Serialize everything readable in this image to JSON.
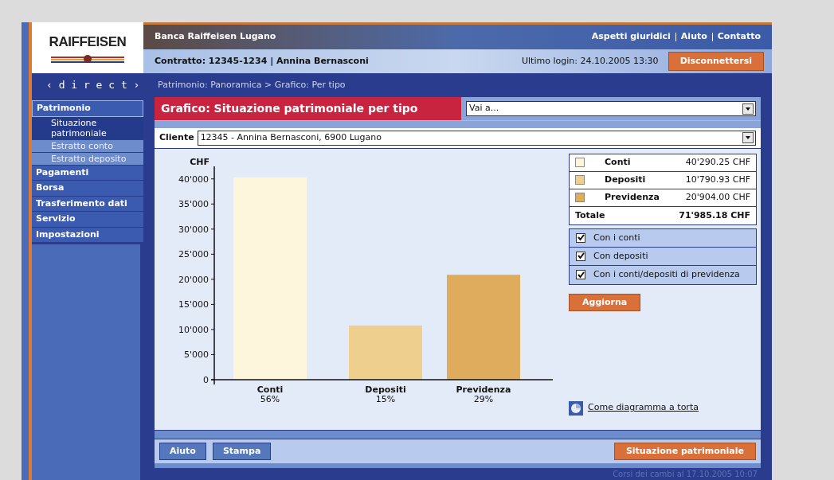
{
  "logo": {
    "text": "RAIFFEISEN"
  },
  "header": {
    "bank": "Banca Raiffeisen Lugano",
    "links": [
      "Aspetti giuridici",
      "Aiuto",
      "Contatto"
    ],
    "contract": "Contratto: 12345-1234 | Annina Bernasconi",
    "last_login": "Ultimo login: 24.10.2005 13:30",
    "logout": "Disconnettersi"
  },
  "brand": "‹ d i r e c t ›",
  "breadcrumb": "Patrimonio: Panoramica > Grafico: Per tipo",
  "sidebar": {
    "items": [
      {
        "label": "Patrimonio",
        "selected": true,
        "children": [
          {
            "label": "Situazione patrimoniale",
            "selected": true
          },
          {
            "label": "Estratto conto",
            "selected": false
          },
          {
            "label": "Estratto deposito",
            "selected": false
          }
        ]
      },
      {
        "label": "Pagamenti",
        "selected": false
      },
      {
        "label": "Borsa",
        "selected": false
      },
      {
        "label": "Trasferimento dati",
        "selected": false
      },
      {
        "label": "Servizio",
        "selected": false
      },
      {
        "label": "Impostazioni",
        "selected": false
      }
    ]
  },
  "page_title": "Grafico: Situazione patrimoniale per tipo",
  "goto_select": {
    "value": "Vai a..."
  },
  "client": {
    "label": "Cliente",
    "value": "12345 - Annina Bernasconi, 6900 Lugano"
  },
  "chart": {
    "percentages": [
      "56%",
      "15%",
      "29%"
    ],
    "chart_data": {
      "type": "bar",
      "ylabel": "CHF",
      "categories": [
        "Conti",
        "Depositi",
        "Previdenza"
      ],
      "series": [
        {
          "values": [
            40300,
            10800,
            20900
          ]
        }
      ],
      "ylim": [
        0,
        42500
      ],
      "yticks": [
        {
          "value": 0,
          "label": "0"
        },
        {
          "value": 5000,
          "label": "5'000"
        },
        {
          "value": 10000,
          "label": "10'000"
        },
        {
          "value": 15000,
          "label": "15'000"
        },
        {
          "value": 20000,
          "label": "20'000"
        },
        {
          "value": 25000,
          "label": "25'000"
        },
        {
          "value": 30000,
          "label": "30'000"
        },
        {
          "value": 35000,
          "label": "35'000"
        },
        {
          "value": 40000,
          "label": "40'000"
        }
      ]
    }
  },
  "legend": {
    "items": [
      {
        "label": "Conti",
        "amount": "40'290.25 CHF",
        "color": "#fdf6dc"
      },
      {
        "label": "Depositi",
        "amount": "10'790.93 CHF",
        "color": "#efcf8e"
      },
      {
        "label": "Previdenza",
        "amount": "20'904.00 CHF",
        "color": "#dfab5c"
      }
    ],
    "total_label": "Totale",
    "total": "71'985.18 CHF"
  },
  "options": [
    {
      "label": "Con i conti",
      "checked": true
    },
    {
      "label": "Con depositi",
      "checked": true
    },
    {
      "label": "Con i conti/depositi di previdenza",
      "checked": true
    }
  ],
  "update_button": "Aggiorna",
  "pie_link": "Come diagramma a torta",
  "footer_buttons": [
    "Aiuto",
    "Stampa"
  ],
  "summary_button": "Situazione patrimoniale",
  "rates_note": "Corsi dei cambi al 17.10.2005 10:07"
}
